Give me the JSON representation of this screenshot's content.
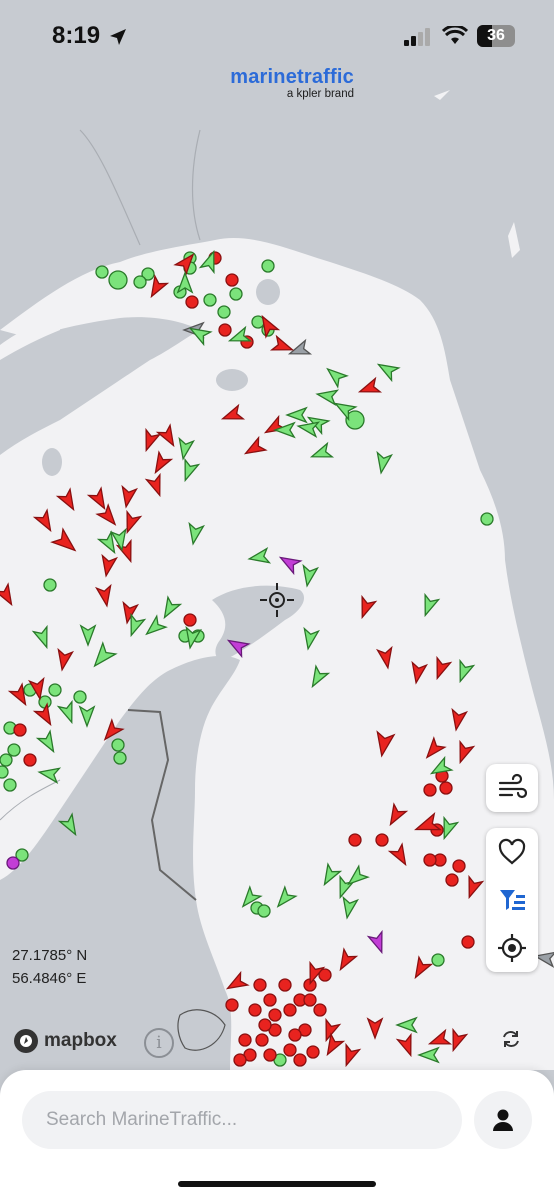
{
  "status_bar": {
    "time": "8:19",
    "battery": "36"
  },
  "brand": {
    "name": "marinetraffic",
    "tagline": "a kpler brand"
  },
  "map": {
    "coordinates": {
      "lat": "27.1785° N",
      "lon": "56.4846° E"
    },
    "attribution": "mapbox",
    "info_symbol": "i",
    "colors": {
      "land": "#c7cbd1",
      "water": "#f2f2f4",
      "cargo_green": "#7be37b",
      "tanker_red": "#e8231f",
      "passenger_purple": "#c23dd6",
      "unknown_gray": "#9aa0a6",
      "outline_dark": "#1f6b1f"
    }
  },
  "side_controls": {
    "top": [
      {
        "icon": "wind-icon"
      }
    ],
    "bottom": [
      {
        "icon": "heart-icon"
      },
      {
        "icon": "filter-icon"
      },
      {
        "icon": "locate-icon"
      }
    ]
  },
  "search": {
    "placeholder": "Search MarineTraffic..."
  },
  "icons": {
    "profile": "person-icon",
    "refresh": "refresh-icon",
    "crosshair": "crosshair-icon"
  }
}
